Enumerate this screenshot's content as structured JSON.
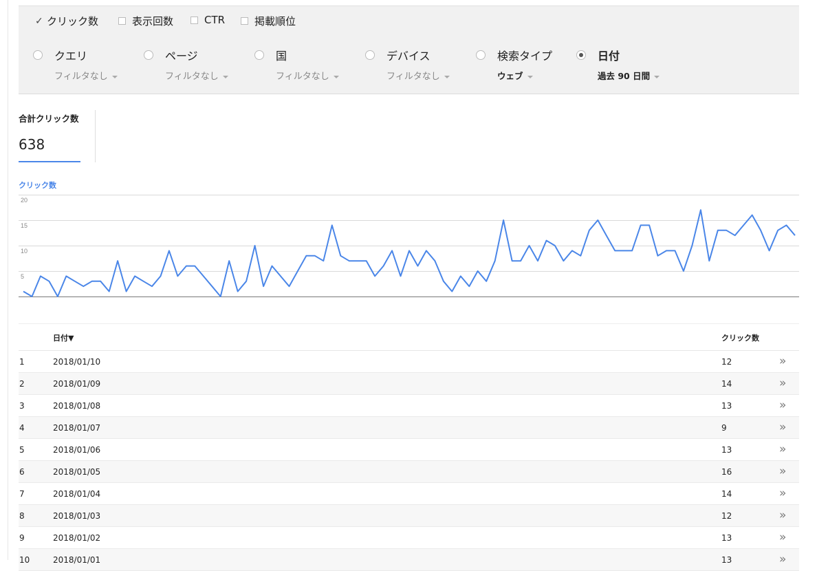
{
  "metrics": [
    {
      "label": "クリック数",
      "checked": true
    },
    {
      "label": "表示回数",
      "checked": false
    },
    {
      "label": "CTR",
      "checked": false
    },
    {
      "label": "掲載順位",
      "checked": false
    }
  ],
  "dimensions": [
    {
      "label": "クエリ",
      "filter": "フィルタなし",
      "selected": false,
      "filter_set": false
    },
    {
      "label": "ページ",
      "filter": "フィルタなし",
      "selected": false,
      "filter_set": false
    },
    {
      "label": "国",
      "filter": "フィルタなし",
      "selected": false,
      "filter_set": false
    },
    {
      "label": "デバイス",
      "filter": "フィルタなし",
      "selected": false,
      "filter_set": false
    },
    {
      "label": "検索タイプ",
      "filter": "ウェブ",
      "selected": false,
      "filter_set": true
    },
    {
      "label": "日付",
      "filter": "過去 90 日間",
      "selected": true,
      "filter_set": true
    }
  ],
  "totals": {
    "label": "合計クリック数",
    "value": "638"
  },
  "chart_data": {
    "type": "line",
    "title": "クリック数",
    "ylim": [
      0,
      20
    ],
    "yticks": [
      5,
      10,
      15,
      20
    ],
    "color": "#4a86e8",
    "series": [
      {
        "values": [
          1,
          0,
          4,
          3,
          0,
          4,
          3,
          2,
          3,
          3,
          1,
          7,
          1,
          4,
          3,
          2,
          4,
          9,
          4,
          6,
          6,
          4,
          2,
          0,
          7,
          1,
          3,
          10,
          2,
          6,
          4,
          2,
          5,
          8,
          8,
          7,
          14,
          8,
          7,
          7,
          7,
          4,
          6,
          9,
          4,
          9,
          6,
          9,
          7,
          3,
          1,
          4,
          2,
          5,
          3,
          7,
          15,
          7,
          7,
          10,
          7,
          11,
          10,
          7,
          9,
          8,
          13,
          15,
          12,
          9,
          9,
          9,
          14,
          14,
          8,
          9,
          9,
          5,
          10,
          17,
          7,
          13,
          13,
          12,
          14,
          16,
          13,
          9,
          13,
          14,
          12
        ]
      }
    ]
  },
  "table": {
    "col_date": "日付▼",
    "col_clicks": "クリック数",
    "arrow": "»",
    "rows": [
      {
        "idx": "1",
        "date": "2018/01/10",
        "clicks": "12"
      },
      {
        "idx": "2",
        "date": "2018/01/09",
        "clicks": "14"
      },
      {
        "idx": "3",
        "date": "2018/01/08",
        "clicks": "13"
      },
      {
        "idx": "4",
        "date": "2018/01/07",
        "clicks": "9"
      },
      {
        "idx": "5",
        "date": "2018/01/06",
        "clicks": "13"
      },
      {
        "idx": "6",
        "date": "2018/01/05",
        "clicks": "16"
      },
      {
        "idx": "7",
        "date": "2018/01/04",
        "clicks": "14"
      },
      {
        "idx": "8",
        "date": "2018/01/03",
        "clicks": "12"
      },
      {
        "idx": "9",
        "date": "2018/01/02",
        "clicks": "13"
      },
      {
        "idx": "10",
        "date": "2018/01/01",
        "clicks": "13"
      }
    ]
  }
}
